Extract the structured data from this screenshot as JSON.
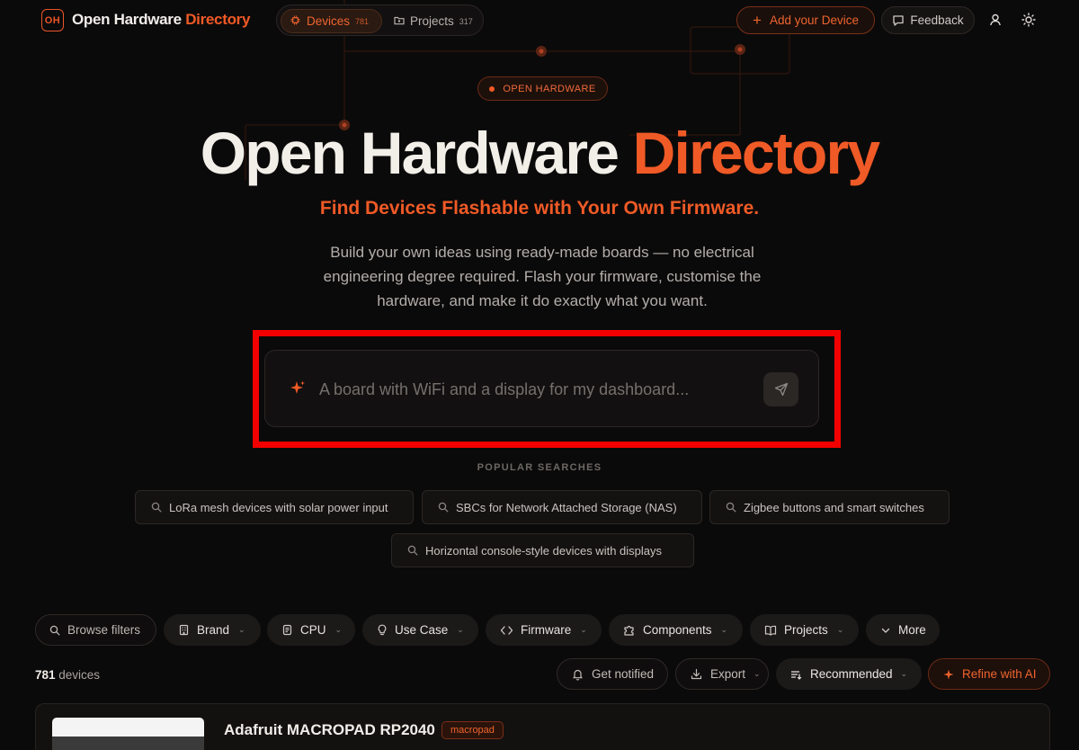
{
  "header": {
    "logo_mark": "OH",
    "brand_part1": "Open Hardware ",
    "brand_part2": "Directory",
    "nav": [
      {
        "label": "Devices",
        "count": "781",
        "active": true
      },
      {
        "label": "Projects",
        "count": "317",
        "active": false
      }
    ],
    "add_device_label": "Add your Device",
    "feedback_label": "Feedback",
    "icons": [
      "user-icon",
      "sun-icon"
    ]
  },
  "hero": {
    "badge": "OPEN HARDWARE",
    "title_part1": "Open Hardware ",
    "title_part2": "Directory",
    "tagline": "Find Devices Flashable with Your Own Firmware.",
    "description": "Build your own ideas using ready-made boards — no electrical engineering degree required. Flash your firmware, customise the hardware, and make it do exactly what you want."
  },
  "search": {
    "placeholder": "A board with WiFi and a display for my dashboard...",
    "value": ""
  },
  "popular": {
    "label": "POPULAR SEARCHES",
    "items": [
      "LoRa mesh devices with solar power input",
      "SBCs for Network Attached Storage (NAS)",
      "Zigbee buttons and smart switches",
      "Horizontal console-style devices with displays"
    ]
  },
  "filters": {
    "items": [
      {
        "label": "Browse filters",
        "icon": "search-icon"
      },
      {
        "label": "Brand",
        "icon": "building-icon"
      },
      {
        "label": "CPU",
        "icon": "cpu-icon"
      },
      {
        "label": "Use Case",
        "icon": "lightbulb-icon"
      },
      {
        "label": "Firmware",
        "icon": "code-icon"
      },
      {
        "label": "Components",
        "icon": "puzzle-icon"
      },
      {
        "label": "Projects",
        "icon": "book-icon"
      },
      {
        "label": "More",
        "icon": "chevron-down-icon"
      }
    ]
  },
  "results": {
    "count": "781",
    "count_suffix": " devices",
    "get_notified": "Get notified",
    "export": "Export",
    "sort": "Recommended",
    "refine": "Refine with AI"
  },
  "devices": [
    {
      "name": "Adafruit MACROPAD RP2040",
      "tag": "macropad"
    }
  ],
  "colors": {
    "accent": "#f05a26",
    "background": "#0b0a0a",
    "highlight": "#f20000"
  }
}
